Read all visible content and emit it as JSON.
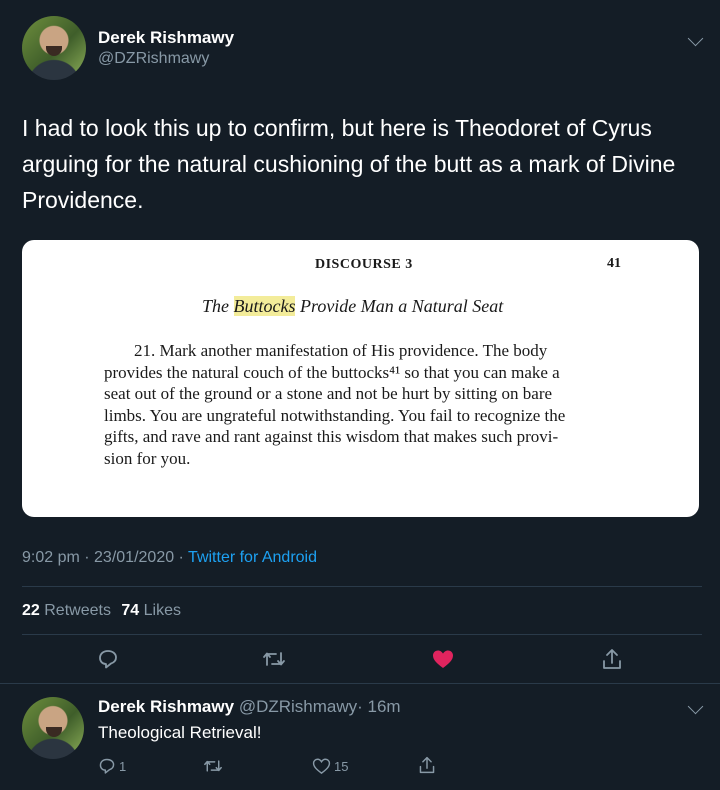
{
  "tweet": {
    "author_name": "Derek Rishmawy",
    "author_handle": "@DZRishmawy",
    "text": "I had to look this up to confirm, but here is Theodoret of Cyrus arguing for the natural cushioning of the butt as a mark of Divine Providence.",
    "time": "9:02 pm · 23/01/2020 · ",
    "source": "Twitter for Android",
    "retweet_count": "22",
    "retweet_label": "Retweets",
    "like_count": "74",
    "like_label": "Likes"
  },
  "book_page": {
    "header_left": "DISCOURSE 3",
    "header_right": "41",
    "heading_pre": "The ",
    "heading_highlight": "Buttocks",
    "heading_post": " Provide Man a Natural Seat",
    "paragraph_lines": [
      "21. Mark another manifestation of His providence. The body",
      "provides the natural couch of the buttocks⁴¹ so that you can make a",
      "seat out of the ground or a stone and not be hurt by sitting on bare",
      "limbs. You are ungrateful notwithstanding. You fail to recognize the",
      "gifts, and rave and rant against this wisdom that makes such provi-",
      "sion for you."
    ]
  },
  "reply": {
    "author_name": "Derek Rishmawy",
    "author_handle": "@DZRishmawy",
    "time": "· 16m",
    "text": "Theological Retrieval!",
    "reply_count": "1",
    "like_count": "15"
  },
  "colors": {
    "background": "#141d26",
    "like_active": "#e0245e",
    "link": "#1da1f2",
    "muted": "#8899a6"
  },
  "icons": [
    "reply-icon",
    "retweet-icon",
    "like-icon",
    "share-icon",
    "chevron-down-icon"
  ]
}
